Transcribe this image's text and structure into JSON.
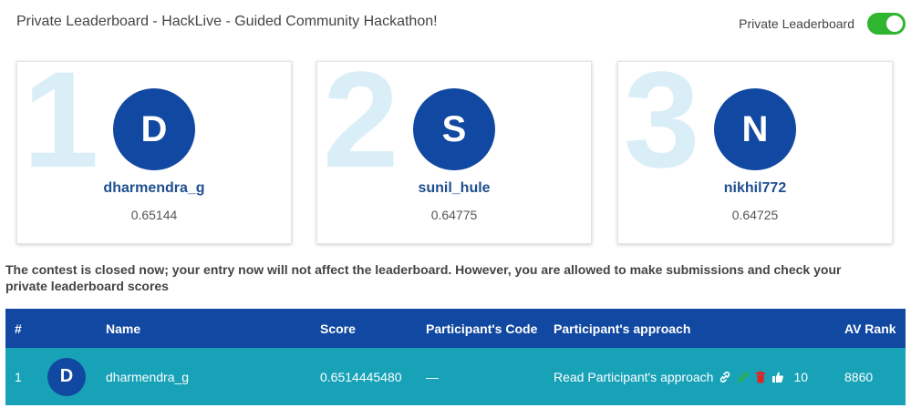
{
  "header": {
    "title": "Private Leaderboard - HackLive - Guided Community Hackathon!",
    "toggle_label": "Private Leaderboard",
    "toggle_on": true,
    "toggle_color": "#2fb52f"
  },
  "podium": [
    {
      "rank": "1",
      "initial": "D",
      "username": "dharmendra_g",
      "score": "0.65144"
    },
    {
      "rank": "2",
      "initial": "S",
      "username": "sunil_hule",
      "score": "0.64775"
    },
    {
      "rank": "3",
      "initial": "N",
      "username": "nikhil772",
      "score": "0.64725"
    }
  ],
  "notice": "The contest is closed now; your entry now will not affect the leaderboard. However, you are allowed to make submissions and check your private leaderboard scores",
  "table": {
    "headers": {
      "rank": "#",
      "name": "Name",
      "score": "Score",
      "code": "Participant's Code",
      "approach": "Participant's approach",
      "av_rank": "AV Rank"
    },
    "rows": [
      {
        "rank": "1",
        "initial": "D",
        "name": "dharmendra_g",
        "score": "0.6514445480",
        "code": "—",
        "approach": "Read Participant's approach",
        "likes": "10",
        "av_rank": "8860"
      }
    ]
  },
  "colors": {
    "brand_blue": "#1148a1",
    "row_teal": "#17a2b8",
    "rank_watermark": "#d9eef7",
    "edit_green": "#2fb52f",
    "delete_red": "#e02424"
  },
  "icons": [
    "link-icon",
    "edit-icon",
    "delete-icon",
    "thumbs-up-icon"
  ]
}
